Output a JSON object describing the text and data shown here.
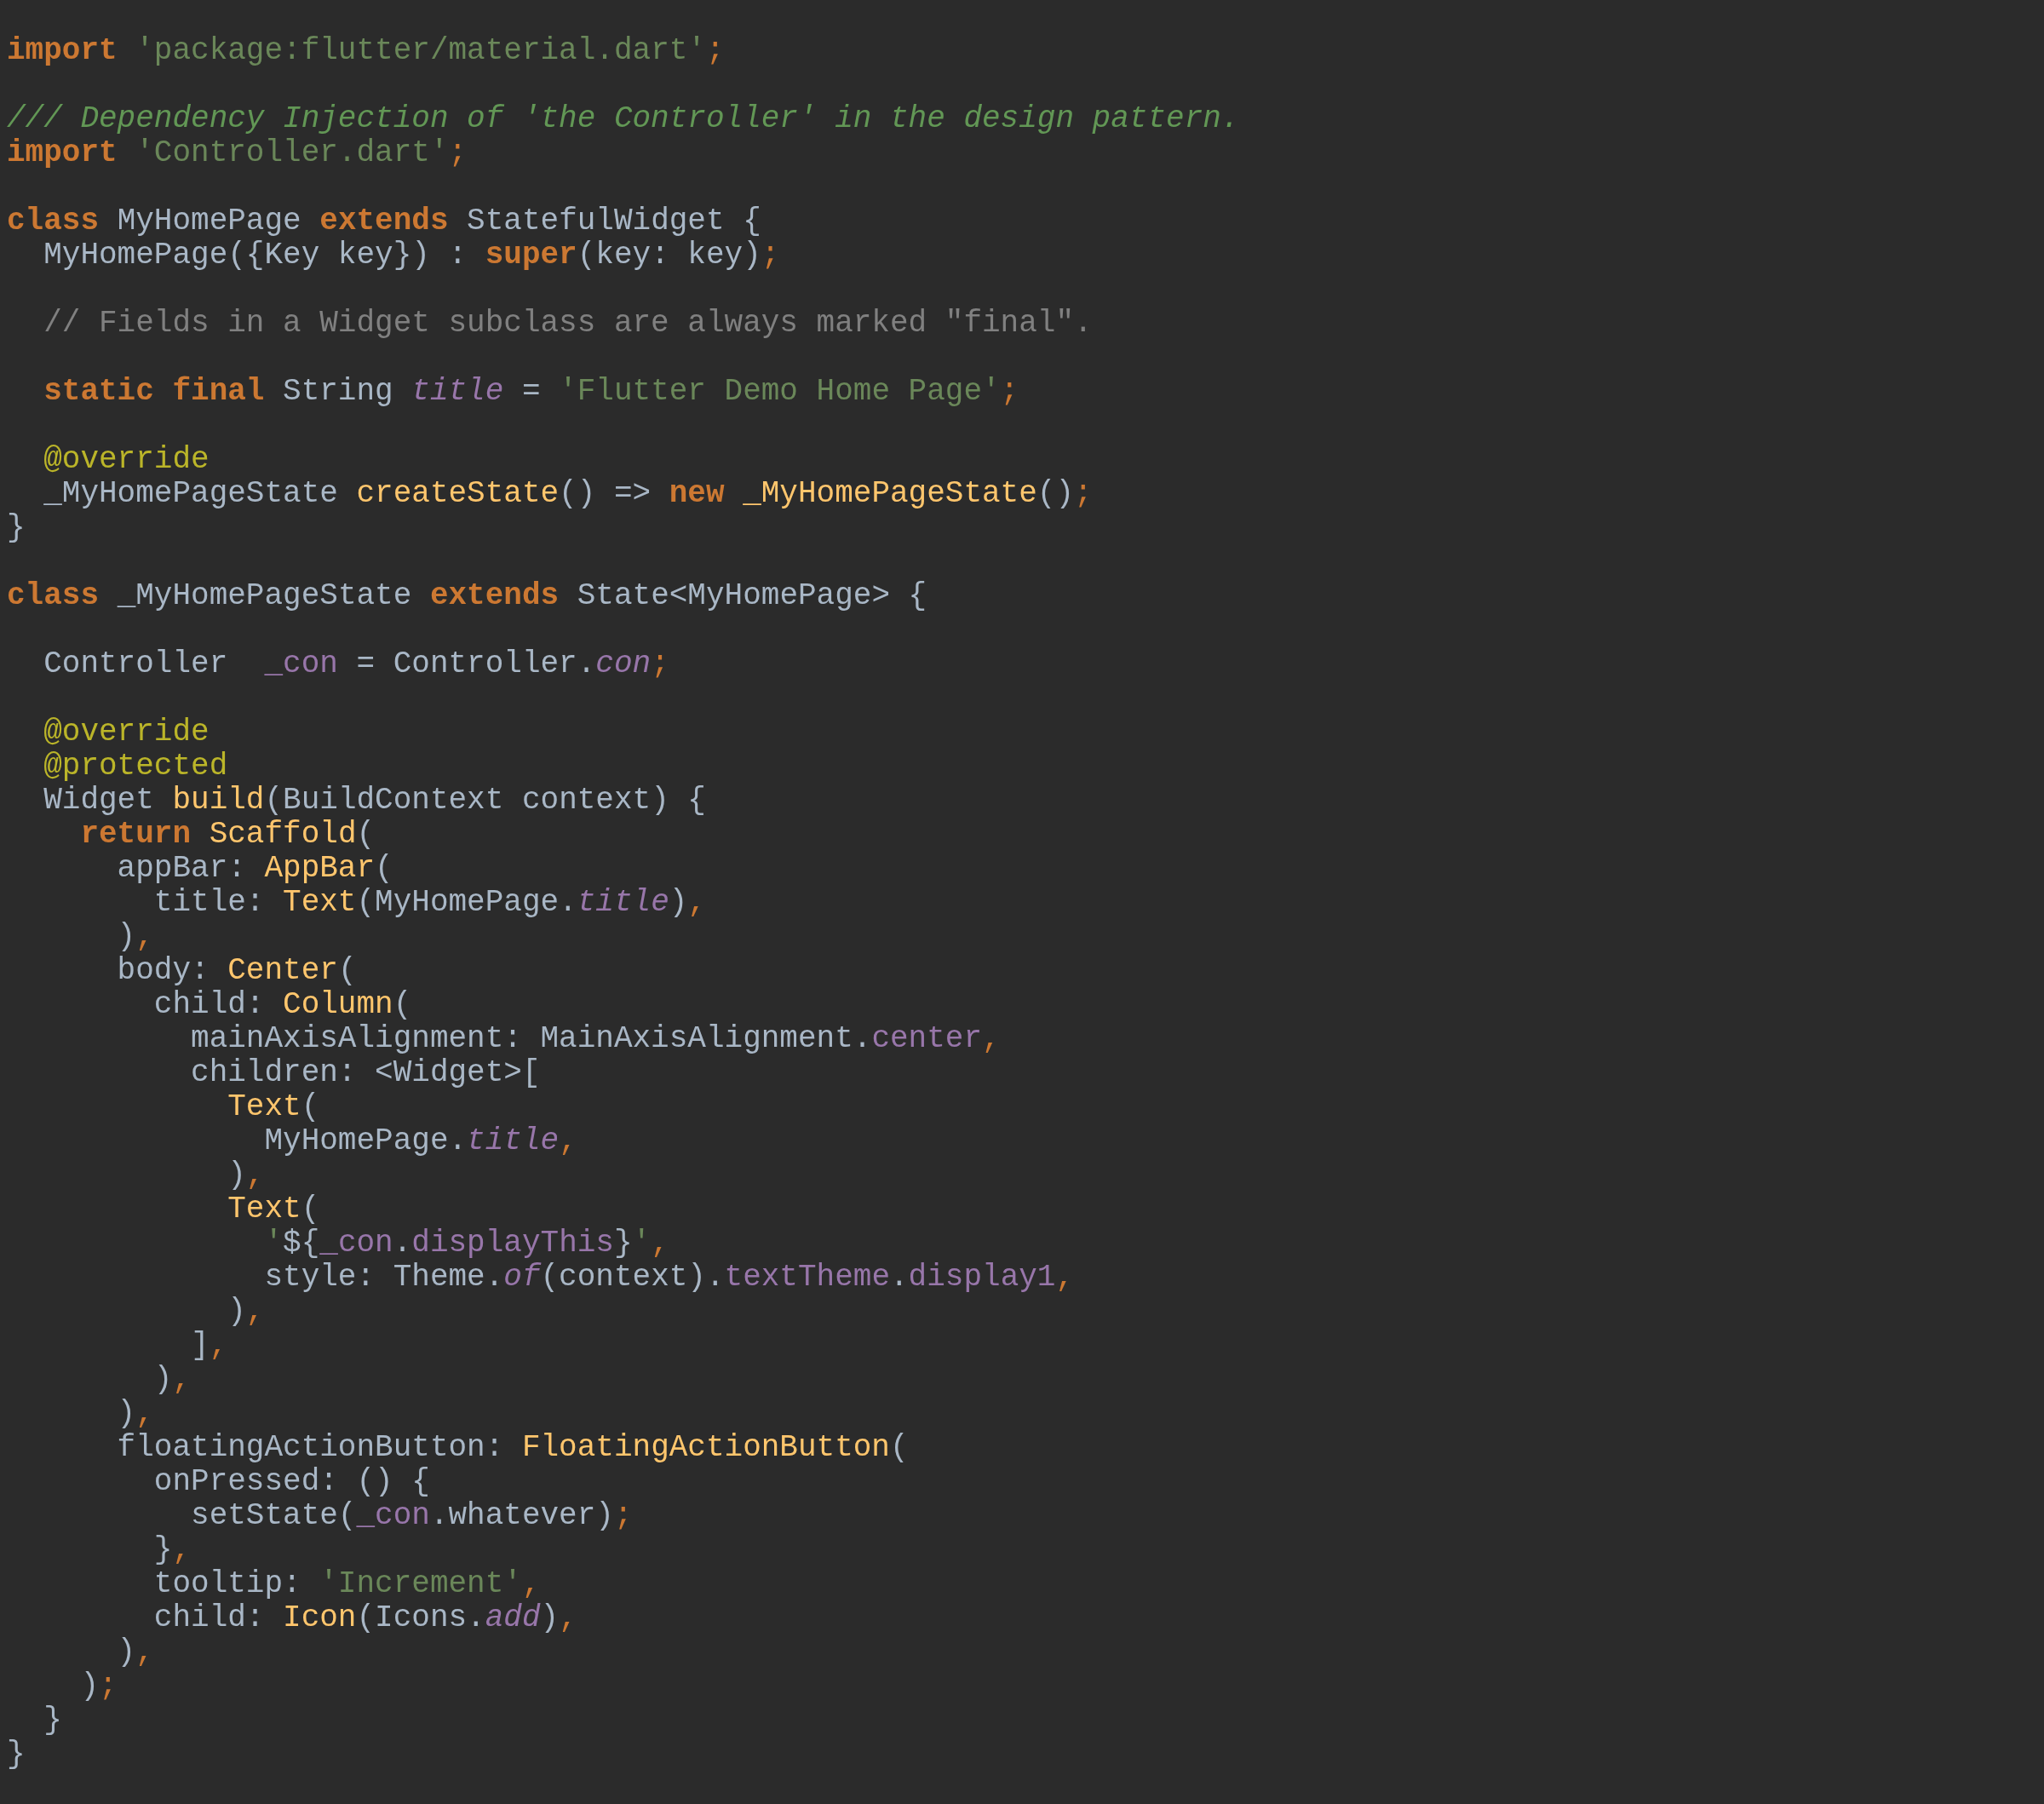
{
  "editor": {
    "lines": [
      {
        "tokens": [
          {
            "text": "import",
            "kind": "kw"
          },
          {
            "text": " 'package:flutter/material.dart'",
            "kind": "str"
          },
          {
            "text": ";",
            "kind": "pu"
          }
        ]
      },
      {
        "kind": "blank"
      },
      {
        "tokens": [
          {
            "text": "/// Dependency Injection of 'the Controller' in the design pattern.",
            "kind": "doc"
          }
        ]
      },
      {
        "tokens": [
          {
            "text": "import",
            "kind": "kw"
          },
          {
            "text": " 'Controller.dart'",
            "kind": "str"
          },
          {
            "text": ";",
            "kind": "pu"
          }
        ]
      },
      {
        "kind": "blank"
      },
      {
        "tokens": [
          {
            "text": "class",
            "kind": "kw"
          },
          {
            "text": " MyHomePage ",
            "kind": "p"
          },
          {
            "text": "extends",
            "kind": "kw"
          },
          {
            "text": " StatefulWidget {",
            "kind": "p"
          }
        ]
      },
      {
        "tokens": [
          {
            "text": "  MyHomePage({Key key}) : ",
            "kind": "p"
          },
          {
            "text": "super",
            "kind": "kw"
          },
          {
            "text": "(key: key)",
            "kind": "p"
          },
          {
            "text": ";",
            "kind": "pu"
          }
        ]
      },
      {
        "kind": "blank"
      },
      {
        "tokens": [
          {
            "text": "  // Fields in a Widget subclass are always marked \"final\".",
            "kind": "cmt"
          }
        ]
      },
      {
        "kind": "blank"
      },
      {
        "tokens": [
          {
            "text": "  static final",
            "kind": "kw"
          },
          {
            "text": " String ",
            "kind": "p"
          },
          {
            "text": "title",
            "kind": "sfld"
          },
          {
            "text": " = ",
            "kind": "p"
          },
          {
            "text": "'Flutter Demo Home Page'",
            "kind": "str"
          },
          {
            "text": ";",
            "kind": "pu"
          }
        ]
      },
      {
        "kind": "blank"
      },
      {
        "tokens": [
          {
            "text": "  @override",
            "kind": "ann"
          }
        ]
      },
      {
        "tokens": [
          {
            "text": "  _MyHomePageState ",
            "kind": "p"
          },
          {
            "text": "createState",
            "kind": "fn"
          },
          {
            "text": "() => ",
            "kind": "p"
          },
          {
            "text": "new",
            "kind": "kw"
          },
          {
            "text": " _MyHomePageState",
            "kind": "fn"
          },
          {
            "text": "()",
            "kind": "p"
          },
          {
            "text": ";",
            "kind": "pu"
          }
        ]
      },
      {
        "tokens": [
          {
            "text": "}",
            "kind": "p"
          }
        ]
      },
      {
        "kind": "blank"
      },
      {
        "tokens": [
          {
            "text": "class",
            "kind": "kw"
          },
          {
            "text": " _MyHomePageState ",
            "kind": "p"
          },
          {
            "text": "extends",
            "kind": "kw"
          },
          {
            "text": " State<MyHomePage> {",
            "kind": "p"
          }
        ]
      },
      {
        "kind": "blank"
      },
      {
        "tokens": [
          {
            "text": "  Controller  ",
            "kind": "p"
          },
          {
            "text": "_con",
            "kind": "fld"
          },
          {
            "text": " = Controller.",
            "kind": "p"
          },
          {
            "text": "con",
            "kind": "sfld"
          },
          {
            "text": ";",
            "kind": "pu"
          }
        ]
      },
      {
        "kind": "blank"
      },
      {
        "tokens": [
          {
            "text": "  @override",
            "kind": "ann"
          }
        ]
      },
      {
        "tokens": [
          {
            "text": "  @protected",
            "kind": "ann"
          }
        ]
      },
      {
        "tokens": [
          {
            "text": "  Widget ",
            "kind": "p"
          },
          {
            "text": "build",
            "kind": "fn"
          },
          {
            "text": "(BuildContext context) {",
            "kind": "p"
          }
        ]
      },
      {
        "tokens": [
          {
            "text": "    return",
            "kind": "kw"
          },
          {
            "text": " Scaffold",
            "kind": "fn"
          },
          {
            "text": "(",
            "kind": "p"
          }
        ]
      },
      {
        "tokens": [
          {
            "text": "      appBar: ",
            "kind": "p"
          },
          {
            "text": "AppBar",
            "kind": "fn"
          },
          {
            "text": "(",
            "kind": "p"
          }
        ]
      },
      {
        "tokens": [
          {
            "text": "        title: ",
            "kind": "p"
          },
          {
            "text": "Text",
            "kind": "fn"
          },
          {
            "text": "(MyHomePage.",
            "kind": "p"
          },
          {
            "text": "title",
            "kind": "sfld"
          },
          {
            "text": ")",
            "kind": "p"
          },
          {
            "text": ",",
            "kind": "pu"
          }
        ]
      },
      {
        "tokens": [
          {
            "text": "      )",
            "kind": "p"
          },
          {
            "text": ",",
            "kind": "pu"
          }
        ]
      },
      {
        "tokens": [
          {
            "text": "      body: ",
            "kind": "p"
          },
          {
            "text": "Center",
            "kind": "fn"
          },
          {
            "text": "(",
            "kind": "p"
          }
        ]
      },
      {
        "tokens": [
          {
            "text": "        child: ",
            "kind": "p"
          },
          {
            "text": "Column",
            "kind": "fn"
          },
          {
            "text": "(",
            "kind": "p"
          }
        ]
      },
      {
        "tokens": [
          {
            "text": "          mainAxisAlignment: MainAxisAlignment.",
            "kind": "p"
          },
          {
            "text": "center",
            "kind": "fld"
          },
          {
            "text": ",",
            "kind": "pu"
          }
        ]
      },
      {
        "tokens": [
          {
            "text": "          children: <Widget>[",
            "kind": "p"
          }
        ]
      },
      {
        "tokens": [
          {
            "text": "            Text",
            "kind": "fn"
          },
          {
            "text": "(",
            "kind": "p"
          }
        ]
      },
      {
        "tokens": [
          {
            "text": "              MyHomePage.",
            "kind": "p"
          },
          {
            "text": "title",
            "kind": "sfld"
          },
          {
            "text": ",",
            "kind": "pu"
          }
        ]
      },
      {
        "tokens": [
          {
            "text": "            )",
            "kind": "p"
          },
          {
            "text": ",",
            "kind": "pu"
          }
        ]
      },
      {
        "tokens": [
          {
            "text": "            Text",
            "kind": "fn"
          },
          {
            "text": "(",
            "kind": "p"
          }
        ]
      },
      {
        "tokens": [
          {
            "text": "              '",
            "kind": "str"
          },
          {
            "text": "${",
            "kind": "p"
          },
          {
            "text": "_con",
            "kind": "fld"
          },
          {
            "text": ".",
            "kind": "p"
          },
          {
            "text": "displayThis",
            "kind": "fld"
          },
          {
            "text": "}",
            "kind": "p"
          },
          {
            "text": "'",
            "kind": "str"
          },
          {
            "text": ",",
            "kind": "pu"
          }
        ]
      },
      {
        "tokens": [
          {
            "text": "              style: Theme.",
            "kind": "p"
          },
          {
            "text": "of",
            "kind": "sfld"
          },
          {
            "text": "(context).",
            "kind": "p"
          },
          {
            "text": "textTheme",
            "kind": "fld"
          },
          {
            "text": ".",
            "kind": "p"
          },
          {
            "text": "display1",
            "kind": "fld"
          },
          {
            "text": ",",
            "kind": "pu"
          }
        ]
      },
      {
        "tokens": [
          {
            "text": "            )",
            "kind": "p"
          },
          {
            "text": ",",
            "kind": "pu"
          }
        ]
      },
      {
        "tokens": [
          {
            "text": "          ]",
            "kind": "p"
          },
          {
            "text": ",",
            "kind": "pu"
          }
        ]
      },
      {
        "tokens": [
          {
            "text": "        )",
            "kind": "p"
          },
          {
            "text": ",",
            "kind": "pu"
          }
        ]
      },
      {
        "tokens": [
          {
            "text": "      )",
            "kind": "p"
          },
          {
            "text": ",",
            "kind": "pu"
          }
        ]
      },
      {
        "tokens": [
          {
            "text": "      floatingActionButton: ",
            "kind": "p"
          },
          {
            "text": "FloatingActionButton",
            "kind": "fn"
          },
          {
            "text": "(",
            "kind": "p"
          }
        ]
      },
      {
        "tokens": [
          {
            "text": "        onPressed: () {",
            "kind": "p"
          }
        ]
      },
      {
        "tokens": [
          {
            "text": "          setState(",
            "kind": "p"
          },
          {
            "text": "_con",
            "kind": "fld"
          },
          {
            "text": ".whatever)",
            "kind": "p"
          },
          {
            "text": ";",
            "kind": "pu"
          }
        ]
      },
      {
        "tokens": [
          {
            "text": "        }",
            "kind": "p"
          },
          {
            "text": ",",
            "kind": "pu"
          }
        ]
      },
      {
        "tokens": [
          {
            "text": "        tooltip: ",
            "kind": "p"
          },
          {
            "text": "'Increment'",
            "kind": "str"
          },
          {
            "text": ",",
            "kind": "pu"
          }
        ]
      },
      {
        "tokens": [
          {
            "text": "        child: ",
            "kind": "p"
          },
          {
            "text": "Icon",
            "kind": "fn"
          },
          {
            "text": "(Icons.",
            "kind": "p"
          },
          {
            "text": "add",
            "kind": "sfld"
          },
          {
            "text": ")",
            "kind": "p"
          },
          {
            "text": ",",
            "kind": "pu"
          }
        ]
      },
      {
        "tokens": [
          {
            "text": "      )",
            "kind": "p"
          },
          {
            "text": ",",
            "kind": "pu"
          }
        ]
      },
      {
        "tokens": [
          {
            "text": "    )",
            "kind": "p"
          },
          {
            "text": ";",
            "kind": "pu"
          }
        ]
      },
      {
        "tokens": [
          {
            "text": "  }",
            "kind": "p"
          }
        ]
      },
      {
        "tokens": [
          {
            "text": "}",
            "kind": "p"
          }
        ]
      }
    ]
  }
}
